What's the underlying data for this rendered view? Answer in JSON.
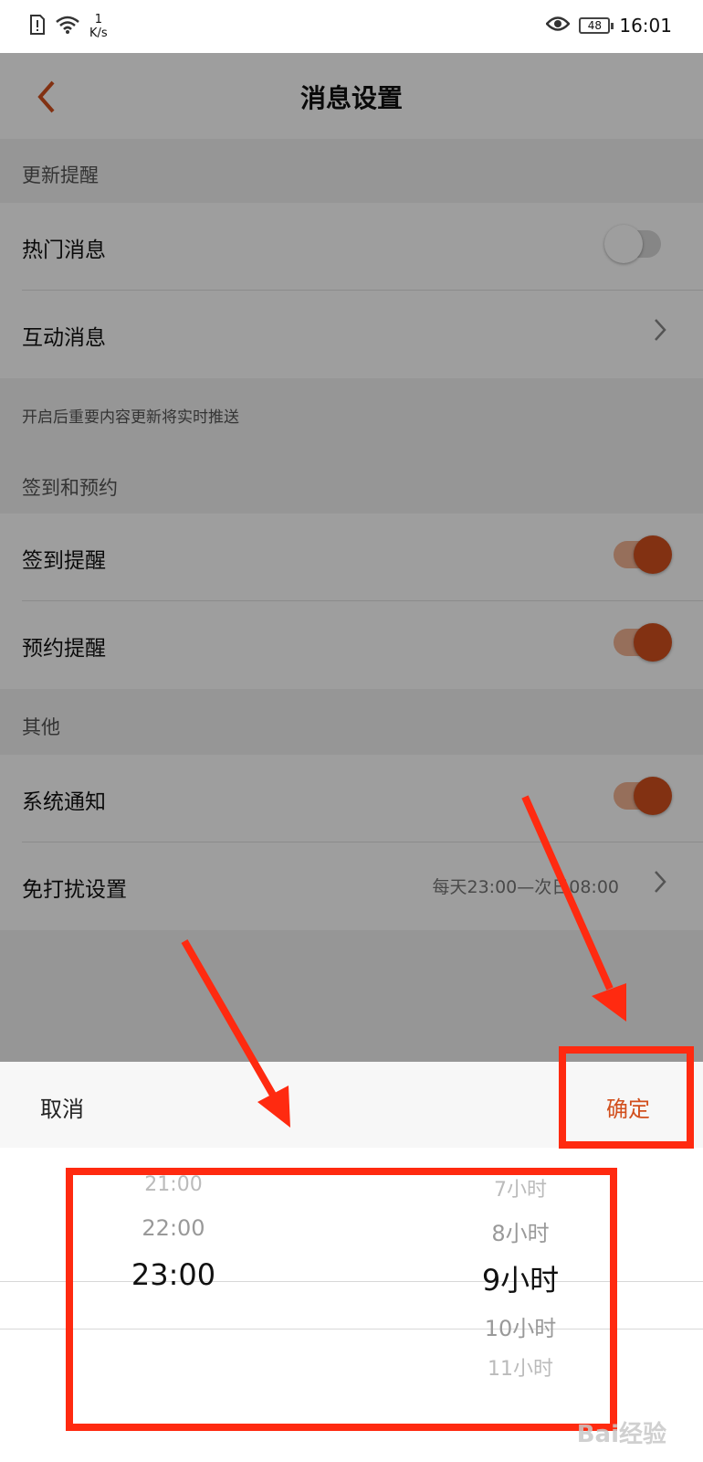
{
  "status_bar": {
    "net_speed_value": "1",
    "net_speed_unit": "K/s",
    "battery": "48",
    "time": "16:01"
  },
  "header": {
    "back_icon": "chevron-left-icon",
    "title": "消息设置"
  },
  "sections": {
    "updates": {
      "title": "更新提醒",
      "rows": [
        {
          "label": "热门消息",
          "control": "toggle",
          "on": false
        },
        {
          "label": "互动消息",
          "control": "chevron"
        }
      ],
      "footnote": "开启后重要内容更新将实时推送"
    },
    "checkin": {
      "title": "签到和预约",
      "rows": [
        {
          "label": "签到提醒",
          "control": "toggle",
          "on": true
        },
        {
          "label": "预约提醒",
          "control": "toggle",
          "on": true
        }
      ]
    },
    "other": {
      "title": "其他",
      "rows": [
        {
          "label": "系统通知",
          "control": "toggle",
          "on": true
        },
        {
          "label": "免打扰设置",
          "control": "chevron",
          "value": "每天23:00—次日08:00"
        }
      ]
    }
  },
  "colors": {
    "accent": "#d2501e",
    "annotation": "#ff2a10"
  },
  "picker": {
    "cancel_label": "取消",
    "confirm_label": "确定",
    "start_times": [
      "21:00",
      "22:00",
      "23:00"
    ],
    "start_selected": "23:00",
    "durations": [
      "7小时",
      "8小时",
      "9小时",
      "10小时",
      "11小时"
    ],
    "duration_selected": "9小时"
  },
  "watermark": "Bai经验"
}
